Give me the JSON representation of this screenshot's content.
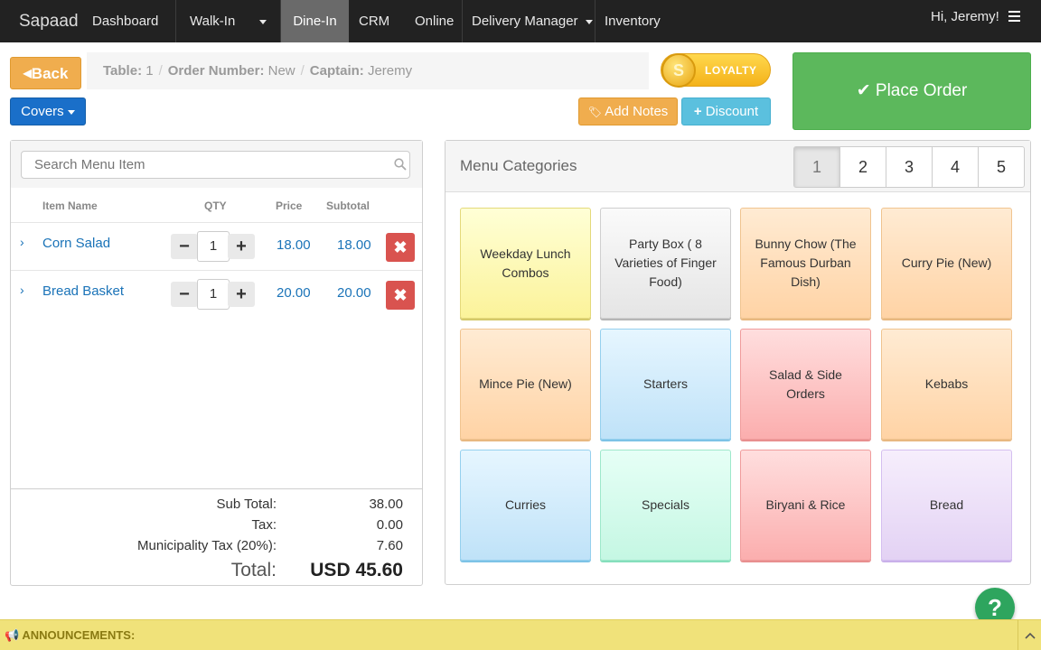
{
  "nav": {
    "brand": "Sapaad",
    "items": [
      "Dashboard",
      "Walk-In",
      "Dine-In",
      "CRM",
      "Online",
      "Delivery Manager",
      "Inventory"
    ],
    "greeting": "Hi, Jeremy!"
  },
  "order_header": {
    "back_label": "Back",
    "covers_label": "Covers",
    "table_label": "Table:",
    "table_value": "1",
    "order_label": "Order Number:",
    "order_value": "New",
    "captain_label": "Captain:",
    "captain_value": "Jeremy",
    "loyalty_label": "LOYALTY",
    "loyalty_coin": "S",
    "add_notes_label": "Add Notes",
    "discount_label": "Discount",
    "place_order_label": "Place Order"
  },
  "order": {
    "search_placeholder": "Search Menu Item",
    "columns": [
      "Item Name",
      "QTY",
      "Price",
      "Subtotal"
    ],
    "items": [
      {
        "name": "Corn Salad",
        "qty": "1",
        "price": "18.00",
        "subtotal": "18.00"
      },
      {
        "name": "Bread Basket",
        "qty": "1",
        "price": "20.00",
        "subtotal": "20.00"
      }
    ],
    "totals": {
      "sub_total_label": "Sub Total:",
      "sub_total": "38.00",
      "tax_label": "Tax:",
      "tax": "0.00",
      "municipality_label": "Municipality Tax (20%):",
      "municipality": "7.60",
      "total_label": "Total:",
      "total": "USD 45.60"
    }
  },
  "menu": {
    "title": "Menu Categories",
    "pages": [
      "1",
      "2",
      "3",
      "4",
      "5"
    ],
    "active_page": "1",
    "categories": [
      {
        "label": "Weekday Lunch Combos",
        "color": "yellow"
      },
      {
        "label": "Party Box ( 8 Varieties of Finger Food)",
        "color": "gray"
      },
      {
        "label": "Bunny Chow (The Famous Durban Dish)",
        "color": "orange"
      },
      {
        "label": "Curry Pie (New)",
        "color": "orange"
      },
      {
        "label": "Mince Pie (New)",
        "color": "orange"
      },
      {
        "label": "Starters",
        "color": "blue"
      },
      {
        "label": "Salad & Side Orders",
        "color": "red"
      },
      {
        "label": "Kebabs",
        "color": "orange"
      },
      {
        "label": "Curries",
        "color": "blue"
      },
      {
        "label": "Specials",
        "color": "green"
      },
      {
        "label": "Biryani & Rice",
        "color": "red"
      },
      {
        "label": "Bread",
        "color": "purple"
      }
    ]
  },
  "help_label": "?",
  "announcements_label": "ANNOUNCEMENTS:",
  "colors": {
    "nav_bg": "#222222",
    "place_order": "#5cb85c",
    "back": "#f0ad4e",
    "covers": "#1a6fc9",
    "discount": "#5bc0de",
    "delete": "#d9534f",
    "link": "#1a73b8"
  }
}
